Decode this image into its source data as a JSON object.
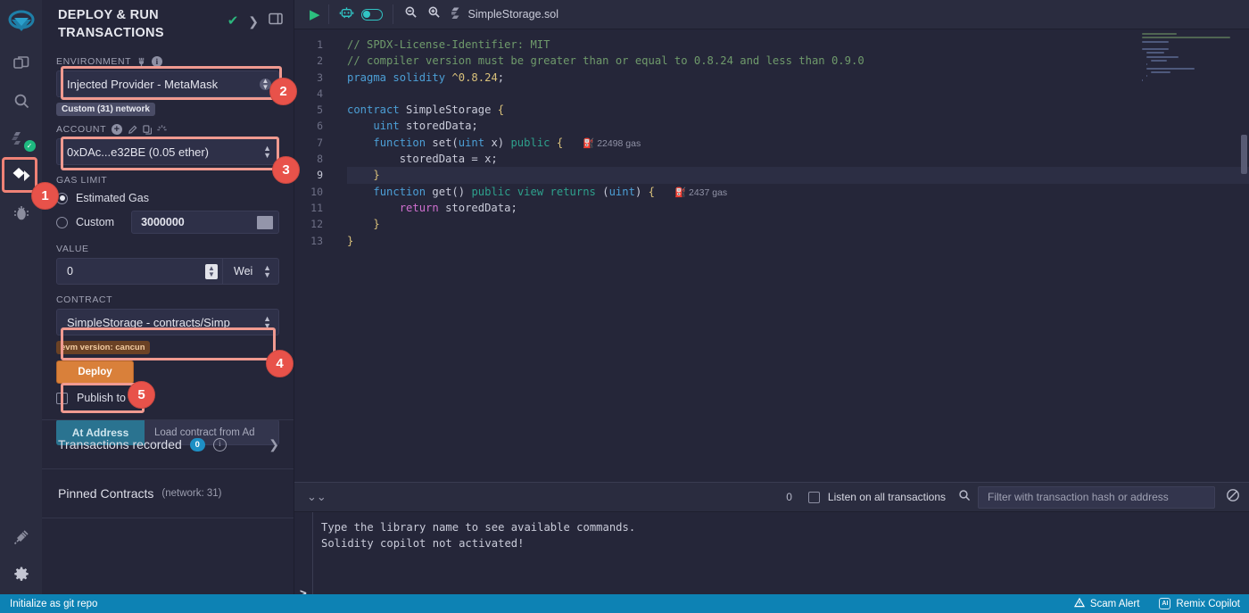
{
  "rail": {
    "items": [
      {
        "name": "remix-logo",
        "label": "Remix"
      },
      {
        "name": "file-explorer",
        "label": "File explorer"
      },
      {
        "name": "search",
        "label": "Search in files"
      },
      {
        "name": "solidity-compiler",
        "label": "Solidity compiler"
      },
      {
        "name": "deploy-run",
        "label": "Deploy & run transactions"
      },
      {
        "name": "debugger",
        "label": "Debugger"
      },
      {
        "name": "plugin-manager",
        "label": "Plugin manager"
      },
      {
        "name": "settings",
        "label": "Settings"
      }
    ]
  },
  "panel": {
    "title": "DEPLOY & RUN TRANSACTIONS",
    "environment": {
      "label": "ENVIRONMENT",
      "value": "Injected Provider - MetaMask",
      "network_tag": "Custom (31) network"
    },
    "account": {
      "label": "ACCOUNT",
      "value": "0xDAc...e32BE (0.05 ether)"
    },
    "gas_limit": {
      "label": "GAS LIMIT",
      "estimated_label": "Estimated Gas",
      "custom_label": "Custom",
      "custom_value": "3000000",
      "selected": "estimated"
    },
    "value": {
      "label": "VALUE",
      "amount": "0",
      "unit": "Wei"
    },
    "contract": {
      "label": "CONTRACT",
      "value": "SimpleStorage - contracts/Simp",
      "evm_tag": "evm version: cancun"
    },
    "deploy_label": "Deploy",
    "publish_ipfs_label": "Publish to IPFS",
    "at_address_label": "At Address",
    "at_address_placeholder": "Load contract from Ad",
    "transactions_recorded": {
      "label": "Transactions recorded",
      "count": "0"
    },
    "pinned_contracts": {
      "label": "Pinned Contracts",
      "network": "(network: 31)"
    }
  },
  "annotations": [
    {
      "id": "1",
      "target": "deploy-run-rail-icon"
    },
    {
      "id": "2",
      "target": "environment-select"
    },
    {
      "id": "3",
      "target": "account-select"
    },
    {
      "id": "4",
      "target": "contract-select"
    },
    {
      "id": "5",
      "target": "deploy-button"
    }
  ],
  "editor": {
    "filename": "SimpleStorage.sol",
    "toolbar": {
      "run_label": "Run",
      "ai_label": "Remix AI",
      "zoom_out_label": "Zoom out",
      "zoom_in_label": "Zoom in"
    },
    "active_line": 9,
    "lines": [
      {
        "n": 1,
        "text": "// SPDX-License-Identifier: MIT"
      },
      {
        "n": 2,
        "text": "// compiler version must be greater than or equal to 0.8.24 and less than 0.9.0"
      },
      {
        "n": 3,
        "text": "pragma solidity ^0.8.24;"
      },
      {
        "n": 4,
        "text": ""
      },
      {
        "n": 5,
        "text": "contract SimpleStorage {"
      },
      {
        "n": 6,
        "text": "    uint storedData;"
      },
      {
        "n": 7,
        "text": "    function set(uint x) public {",
        "gas": "22498 gas"
      },
      {
        "n": 8,
        "text": "        storedData = x;"
      },
      {
        "n": 9,
        "text": "    }"
      },
      {
        "n": 10,
        "text": "    function get() public view returns (uint) {",
        "gas": "2437 gas"
      },
      {
        "n": 11,
        "text": "        return storedData;"
      },
      {
        "n": 12,
        "text": "    }"
      },
      {
        "n": 13,
        "text": "}"
      }
    ]
  },
  "terminal": {
    "count": "0",
    "listen_label": "Listen on all transactions",
    "filter_placeholder": "Filter with transaction hash or address",
    "lines": [
      "Type the library name to see available commands.",
      "Solidity copilot not activated!"
    ],
    "prompt": ">"
  },
  "statusbar": {
    "git_label": "Initialize as git repo",
    "scam_alert_label": "Scam Alert",
    "copilot_label": "Remix Copilot"
  },
  "colors": {
    "accent_blue": "#0d82b4",
    "deploy_orange": "#d9803a",
    "annotation_red": "#e8524a",
    "annotation_border": "#f09a90",
    "success_green": "#2cb67d",
    "panel_bg": "#252639",
    "rail_bg": "#2a2c3f"
  }
}
